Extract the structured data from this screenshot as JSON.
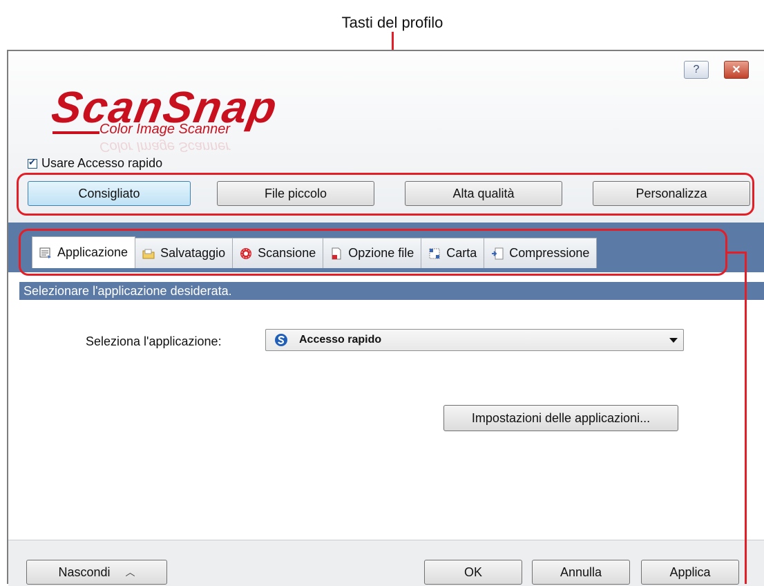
{
  "annotations": {
    "profile_buttons_label": "Tasti del profilo",
    "color": "#e41e26"
  },
  "window": {
    "help_glyph": "?",
    "close_glyph": "✕"
  },
  "logo": {
    "main": "ScanSnap",
    "sub": "Color Image Scanner",
    "color": "#c8101e"
  },
  "quick_access": {
    "checked": true,
    "label": "Usare Accesso rapido"
  },
  "profiles": [
    {
      "label": "Consigliato",
      "active": true
    },
    {
      "label": "File piccolo",
      "active": false
    },
    {
      "label": "Alta qualità",
      "active": false
    },
    {
      "label": "Personalizza",
      "active": false
    }
  ],
  "tabs": [
    {
      "label": "Applicazione",
      "icon": "application-icon",
      "active": true
    },
    {
      "label": "Salvataggio",
      "icon": "folder-icon",
      "active": false
    },
    {
      "label": "Scansione",
      "icon": "scan-icon",
      "active": false
    },
    {
      "label": "Opzione file",
      "icon": "file-option-icon",
      "active": false
    },
    {
      "label": "Carta",
      "icon": "paper-icon",
      "active": false
    },
    {
      "label": "Compressione",
      "icon": "compression-icon",
      "active": false
    }
  ],
  "section": {
    "header": "Selezionare l'applicazione desiderata."
  },
  "application": {
    "select_label": "Seleziona l'applicazione:",
    "selected_value": "Accesso rapido",
    "settings_button": "Impostazioni delle applicazioni..."
  },
  "footer": {
    "hide_label": "Nascondi",
    "ok_label": "OK",
    "cancel_label": "Annulla",
    "apply_label": "Applica"
  }
}
